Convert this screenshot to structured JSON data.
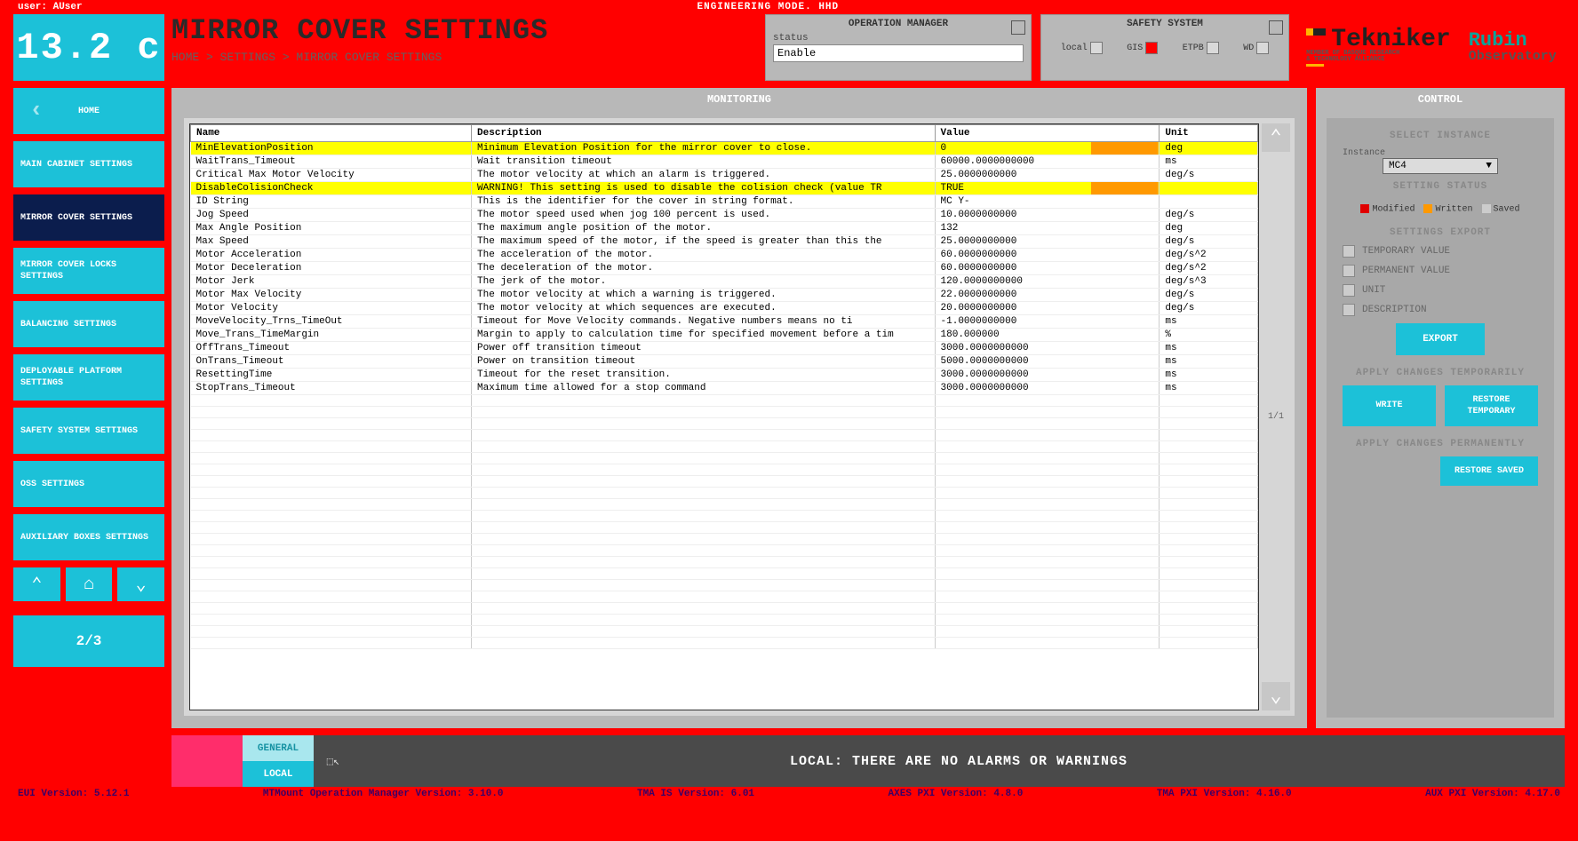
{
  "top": {
    "user": "user: AUser",
    "mode": "ENGINEERING MODE. HHD"
  },
  "sidebar": {
    "version": "13.2 c",
    "items": [
      "HOME",
      "MAIN CABINET SETTINGS",
      "MIRROR COVER SETTINGS",
      "MIRROR COVER LOCKS SETTINGS",
      "BALANCING SETTINGS",
      "DEPLOYABLE PLATFORM SETTINGS",
      "SAFETY SYSTEM SETTINGS",
      "OSS SETTINGS",
      "AUXILIARY BOXES SETTINGS"
    ],
    "page": "2/3"
  },
  "header": {
    "title": "MIRROR COVER SETTINGS",
    "breadcrumb": "HOME > SETTINGS > MIRROR COVER SETTINGS"
  },
  "op_mgr": {
    "title": "OPERATION MANAGER",
    "status_label": "status",
    "status_value": "Enable"
  },
  "safety": {
    "title": "SAFETY SYSTEM",
    "items": [
      "local",
      "GIS",
      "ETPB",
      "WD"
    ]
  },
  "monitoring": {
    "title": "MONITORING",
    "cols": [
      "Name",
      "Description",
      "Value",
      "Unit"
    ],
    "page": "1/1",
    "rows": [
      {
        "hl": true,
        "n": "MinElevationPosition",
        "d": "Minimum Elevation Position for the mirror cover to close.",
        "v": "0",
        "u": "deg"
      },
      {
        "hl": false,
        "n": "WaitTrans_Timeout",
        "d": "Wait transition timeout",
        "v": "60000.0000000000",
        "u": "ms"
      },
      {
        "hl": false,
        "n": "Critical Max Motor Velocity",
        "d": "The motor velocity at which an alarm is triggered.",
        "v": "25.0000000000",
        "u": "deg/s"
      },
      {
        "hl": true,
        "n": "DisableColisionCheck",
        "d": "WARNING! This setting is used to disable the colision check (value TR",
        "v": "TRUE",
        "u": ""
      },
      {
        "hl": false,
        "n": "ID String",
        "d": "This is the identifier for the cover in string format.",
        "v": "MC Y-",
        "u": ""
      },
      {
        "hl": false,
        "n": "Jog Speed",
        "d": "The motor speed used when jog 100 percent is used.",
        "v": "10.0000000000",
        "u": "deg/s"
      },
      {
        "hl": false,
        "n": "Max Angle Position",
        "d": "The maximum angle position of the motor.",
        "v": "132",
        "u": "deg"
      },
      {
        "hl": false,
        "n": "Max Speed",
        "d": "The maximum speed of the motor, if the speed is greater than this the",
        "v": "25.0000000000",
        "u": "deg/s"
      },
      {
        "hl": false,
        "n": "Motor Acceleration",
        "d": "The acceleration of the motor.",
        "v": "60.0000000000",
        "u": "deg/s^2"
      },
      {
        "hl": false,
        "n": "Motor Deceleration",
        "d": "The deceleration of the motor.",
        "v": "60.0000000000",
        "u": "deg/s^2"
      },
      {
        "hl": false,
        "n": "Motor Jerk",
        "d": "The jerk of the motor.",
        "v": "120.0000000000",
        "u": "deg/s^3"
      },
      {
        "hl": false,
        "n": "Motor Max Velocity",
        "d": "The motor velocity at which a warning is triggered.",
        "v": "22.0000000000",
        "u": "deg/s"
      },
      {
        "hl": false,
        "n": "Motor Velocity",
        "d": "The motor velocity at which sequences are executed.",
        "v": "20.0000000000",
        "u": "deg/s"
      },
      {
        "hl": false,
        "n": "MoveVelocity_Trns_TimeOut",
        "d": "Timeout for Move Velocity commands. Negative numbers means no ti",
        "v": "-1.0000000000",
        "u": "ms"
      },
      {
        "hl": false,
        "n": "Move_Trans_TimeMargin",
        "d": "Margin to apply to calculation time for specified movement before a tim",
        "v": "180.000000",
        "u": "%"
      },
      {
        "hl": false,
        "n": "OffTrans_Timeout",
        "d": "Power off transition timeout",
        "v": "3000.0000000000",
        "u": "ms"
      },
      {
        "hl": false,
        "n": "OnTrans_Timeout",
        "d": "Power on transition timeout",
        "v": "5000.0000000000",
        "u": "ms"
      },
      {
        "hl": false,
        "n": "ResettingTime",
        "d": "Timeout for the reset transition.",
        "v": "3000.0000000000",
        "u": "ms"
      },
      {
        "hl": false,
        "n": "StopTrans_Timeout",
        "d": "Maximum time allowed for a stop command",
        "v": "3000.0000000000",
        "u": "ms"
      }
    ]
  },
  "control": {
    "title": "CONTROL",
    "select_instance": "SELECT INSTANCE",
    "instance_label": "Instance",
    "instance_value": "MC4",
    "setting_status": "SETTING STATUS",
    "status": [
      "Modified",
      "Written",
      "Saved"
    ],
    "settings_export": "SETTINGS EXPORT",
    "export_opts": [
      "TEMPORARY VALUE",
      "PERMANENT VALUE",
      "UNIT",
      "DESCRIPTION"
    ],
    "export_btn": "EXPORT",
    "apply_temp": "APPLY CHANGES TEMPORARILY",
    "write_btn": "WRITE",
    "restore_temp_btn": "RESTORE TEMPORARY",
    "apply_perm": "APPLY CHANGES PERMANENTLY",
    "restore_saved_btn": "RESTORE SAVED"
  },
  "footer": {
    "tab1": "GENERAL",
    "tab2": "LOCAL",
    "msg": "LOCAL: THERE ARE NO ALARMS OR WARNINGS"
  },
  "bottom": {
    "v1": "EUI Version: 5.12.1",
    "v2": "MTMount Operation Manager Version: 3.10.0",
    "v3": "TMA IS Version: 6.01",
    "v4": "AXES PXI Version: 4.8.0",
    "v5": "TMA PXI Version: 4.16.0",
    "v6": "AUX PXI Version: 4.17.0"
  }
}
